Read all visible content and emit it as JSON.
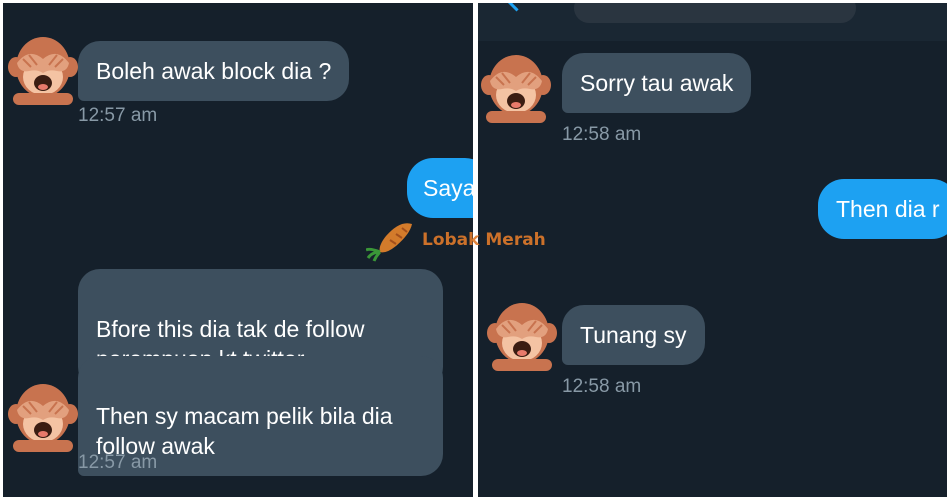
{
  "left_panel": {
    "messages": [
      {
        "text": "Boleh awak block dia ?"
      },
      {
        "text": "Saya"
      },
      {
        "text": "Bfore this dia tak de follow\nperempuan kt twitter"
      },
      {
        "text": "Then sy macam pelik bila dia\nfollow awak"
      }
    ],
    "timestamps": [
      "12:57 am",
      "12:57 am"
    ]
  },
  "right_panel": {
    "messages": [
      {
        "text": "Sorry tau awak"
      },
      {
        "text": "Then dia r"
      },
      {
        "text": "Tunang sy"
      }
    ],
    "timestamps": [
      "12:58 am",
      "12:58 am"
    ]
  },
  "watermark": {
    "brand": "Lobak Merah"
  },
  "avatar": {
    "icon": "see-no-evil-monkey-icon"
  },
  "colors": {
    "background": "#15202b",
    "received_bubble": "#3d4f5e",
    "sent_bubble": "#1da1f2",
    "timestamp": "#8899a6"
  }
}
